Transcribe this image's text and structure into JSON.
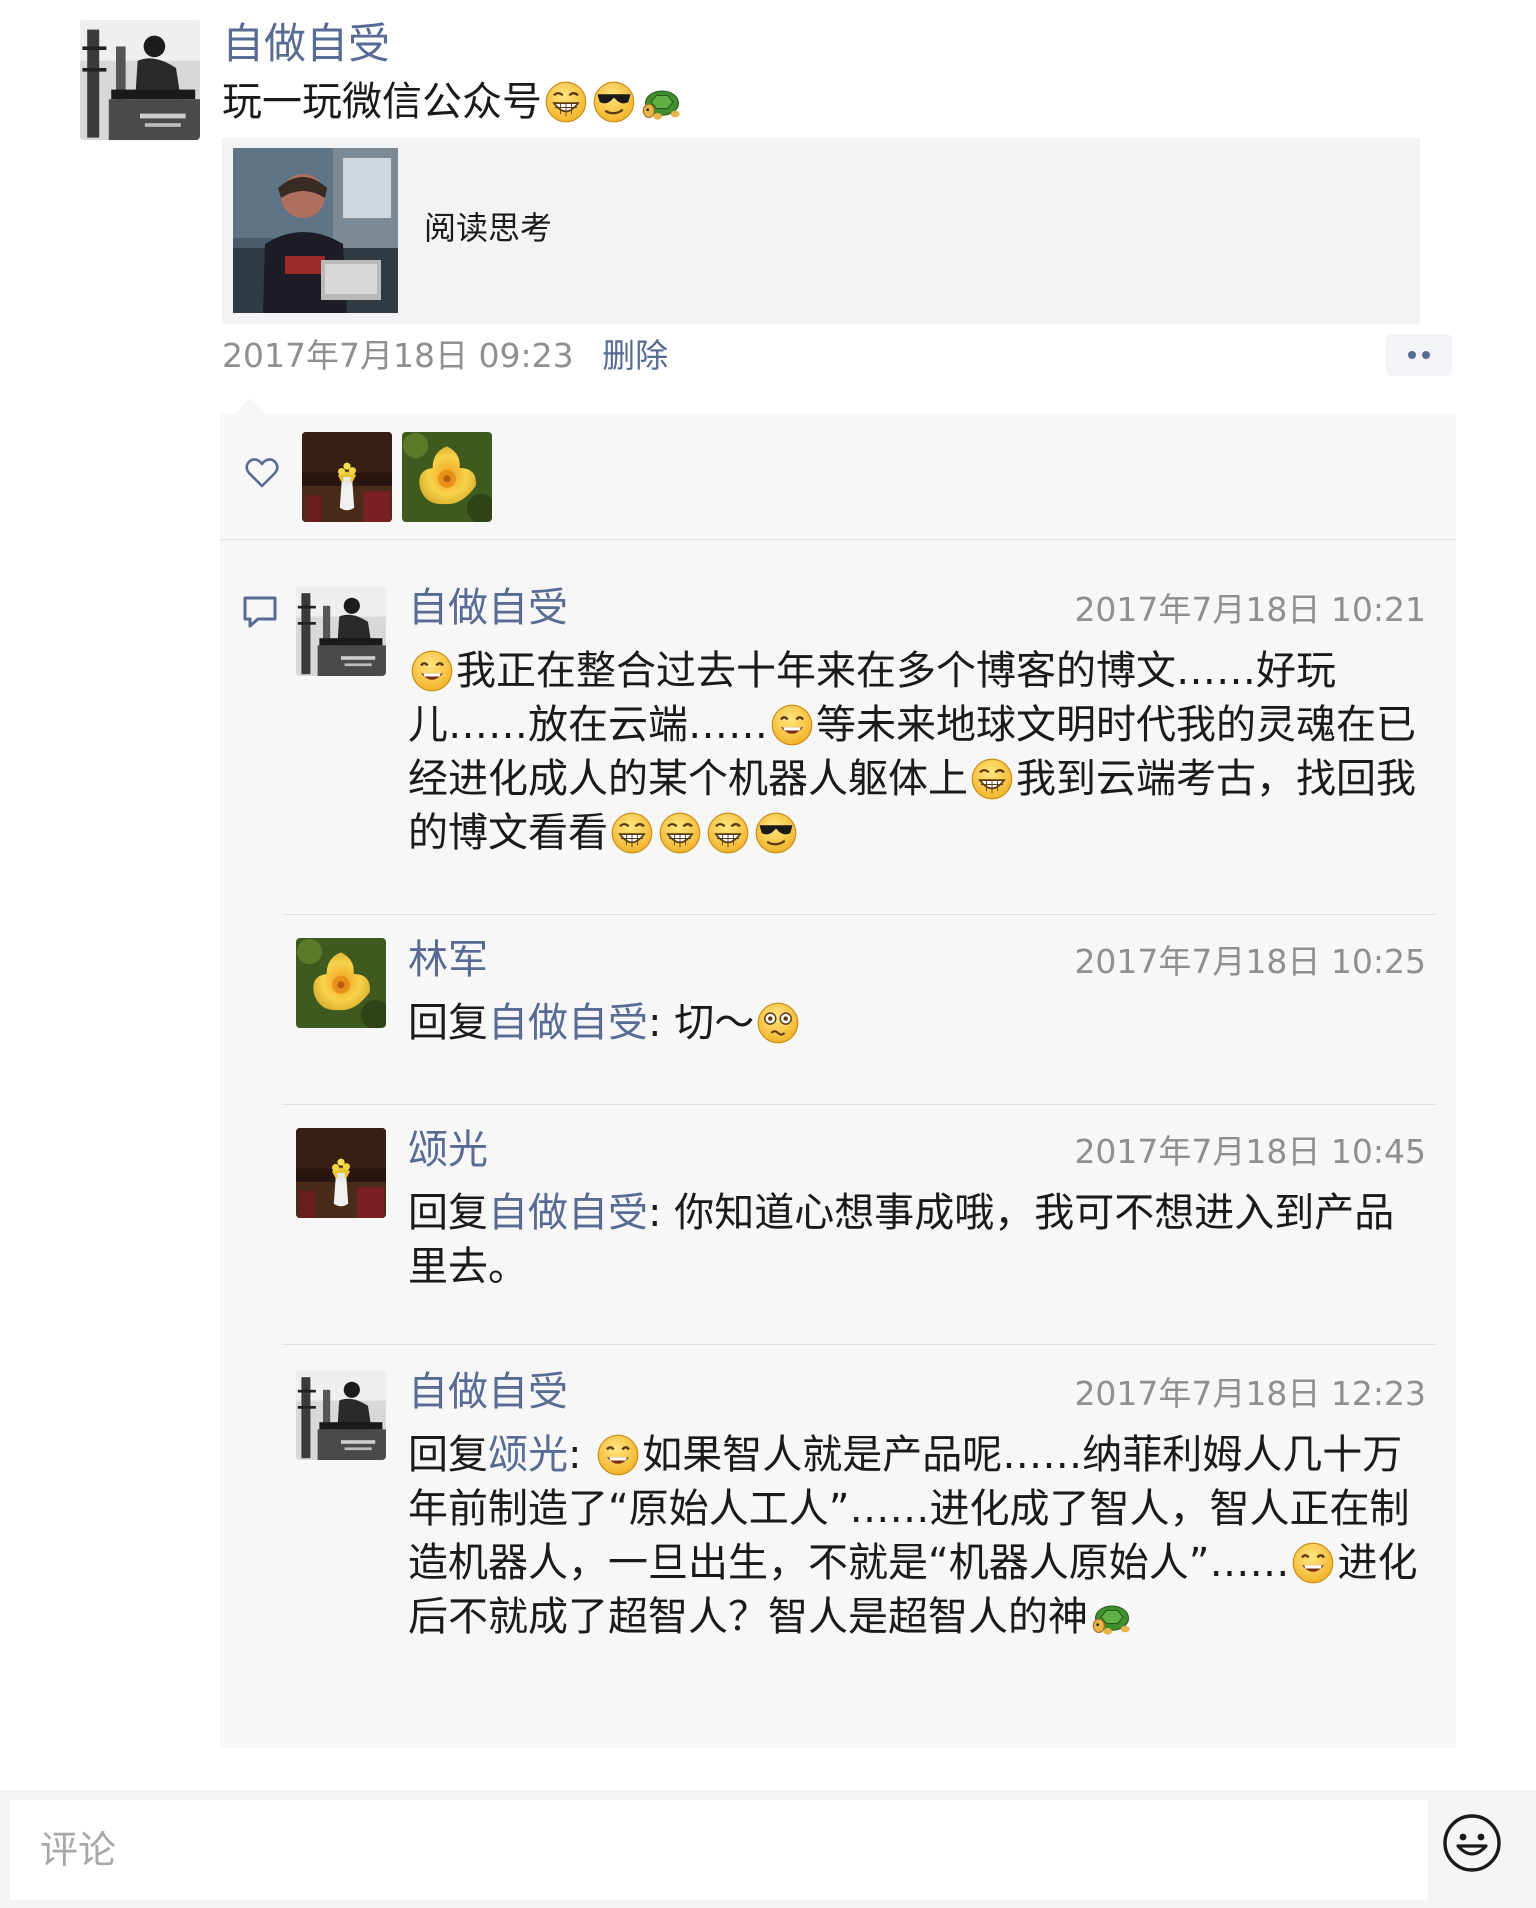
{
  "post": {
    "author": "自做自受",
    "text": "玩一玩微信公众号",
    "text_emojis": [
      "grin-emoji",
      "sunglasses-emoji",
      "turtle-emoji"
    ],
    "share": {
      "title": "阅读思考"
    },
    "timestamp": "2017年7月18日 09:23",
    "delete_label": "删除"
  },
  "comments": [
    {
      "author": "自做自受",
      "time": "2017年7月18日 10:21",
      "segments": [
        {
          "emoji": "smile"
        },
        {
          "text": "我正在整合过去十年来在多个博客的博文……好玩儿……放在云端……"
        },
        {
          "emoji": "smile"
        },
        {
          "text": "等未来地球文明时代我的灵魂在已经进化成人的某个机器人躯体上"
        },
        {
          "emoji": "grin"
        },
        {
          "text": "我到云端考古，找回我的博文看看"
        },
        {
          "emoji": "grin"
        },
        {
          "emoji": "grin"
        },
        {
          "emoji": "grin"
        },
        {
          "emoji": "sunglasses"
        }
      ]
    },
    {
      "author": "林军",
      "time": "2017年7月18日 10:25",
      "reply_prefix": "回复",
      "reply_to": "自做自受",
      "segments": [
        {
          "text": ": 切～"
        },
        {
          "emoji": "dizzy"
        }
      ]
    },
    {
      "author": "颂光",
      "time": "2017年7月18日 10:45",
      "reply_prefix": "回复",
      "reply_to": "自做自受",
      "segments": [
        {
          "text": ": 你知道心想事成哦，我可不想进入到产品里去。"
        }
      ]
    },
    {
      "author": "自做自受",
      "time": "2017年7月18日 12:23",
      "reply_prefix": "回复",
      "reply_to": "颂光",
      "segments": [
        {
          "text": ": "
        },
        {
          "emoji": "smile"
        },
        {
          "text": "如果智人就是产品呢……纳菲利姆人几十万年前制造了“原始人工人”……进化成了智人，智人正在制造机器人，一旦出生，不就是“机器人原始人”……"
        },
        {
          "emoji": "smile"
        },
        {
          "text": "进化后不就成了超智人？智人是超智人的神"
        },
        {
          "emoji": "turtle"
        }
      ]
    }
  ],
  "composer": {
    "placeholder": "评论"
  },
  "colors": {
    "link": "#576b95",
    "time": "#8f8f8f",
    "panel": "#f7f7f7",
    "share_bg": "#f3f3f5"
  }
}
